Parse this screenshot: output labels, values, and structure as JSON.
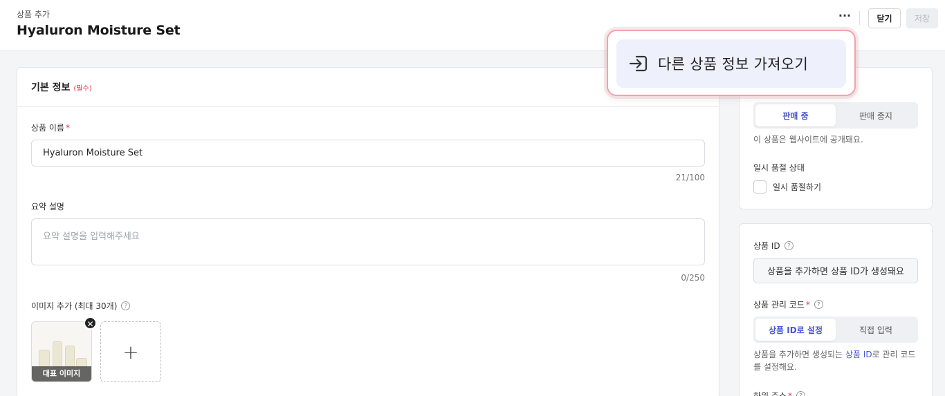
{
  "header": {
    "breadcrumb": "상품 추가",
    "title": "Hyaluron Moisture Set",
    "more_label": "···",
    "close_label": "닫기",
    "save_label": "저장"
  },
  "basic_info": {
    "title": "기본 정보",
    "required_tag": "(필수)",
    "product_name": {
      "label": "상품 이름",
      "required_mark": "*",
      "value": "Hyaluron Moisture Set",
      "counter": "21/100"
    },
    "summary": {
      "label": "요약 설명",
      "placeholder": "요약 설명을 입력해주세요",
      "counter": "0/250"
    },
    "images": {
      "label": "이미지 추가 (최대 30개)",
      "help_icon": "question-circle-icon",
      "main_caption": "대표 이미지",
      "remove_icon": "close-icon",
      "add_icon": "plus-icon",
      "add_symbol": "+"
    }
  },
  "sales_status": {
    "options": [
      "판매 중",
      "판매 중지"
    ],
    "selected": "판매 중",
    "helper": "이 상품은 웹사이트에 공개돼요.",
    "temp_soldout_label": "일시 품절 상태",
    "temp_soldout_checkbox": "일시 품절하기",
    "temp_soldout_checked": false
  },
  "product_id_section": {
    "id_label": "상품 ID",
    "id_value": "상품을 추가하면 상품 ID가 생성돼요",
    "code_label": "상품 관리 코드",
    "required_mark": "*",
    "code_options": [
      "상품 ID로 설정",
      "직접 입력"
    ],
    "code_selected": "상품 ID로 설정",
    "helper_before": "상품을 추가하면 생성되는 ",
    "helper_link": "상품 ID",
    "helper_after": "로 관리 코드를 설정해요.",
    "next_label": "하위 주소"
  },
  "popup": {
    "icon": "import-arrow-icon",
    "label": "다른 상품 정보 가져오기"
  },
  "colors": {
    "accent": "#4b55d6",
    "required": "#e0334b",
    "popup_border": "#f0a3ab",
    "popup_item_bg": "#eef0fb"
  }
}
